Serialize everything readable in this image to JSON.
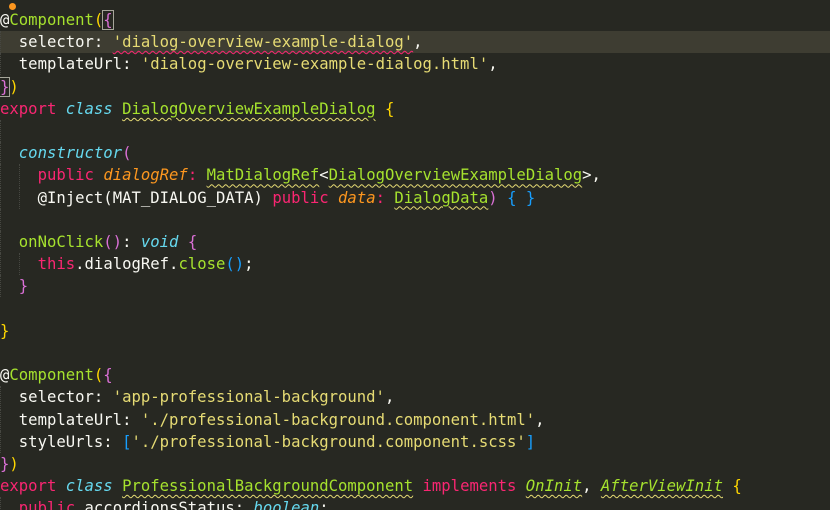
{
  "colors": {
    "background": "#272822",
    "current_line": "#3e3d32",
    "keyword": "#f92672",
    "storage_italic": "#66d9ef",
    "function": "#a6e22e",
    "string": "#e6db74",
    "text": "#f8f8f2",
    "parameter": "#fd971f",
    "bracket_yellow": "#ffd700",
    "bracket_purple": "#da70d6",
    "bracket_blue": "#179fff"
  },
  "lines": [
    [
      {
        "t": "@",
        "c": "#f8f8f2"
      },
      {
        "t": "Component",
        "c": "#a6e22e"
      },
      {
        "t": "(",
        "c": "#ffd700"
      },
      {
        "t": "{",
        "c": "#da70d6",
        "box": true
      }
    ],
    [
      {
        "t": "  selector: ",
        "c": "#f8f8f2"
      },
      {
        "t": "'dialog-overview-example-dialog'",
        "c": "#e6db74",
        "sq": "red"
      },
      {
        "t": ",",
        "c": "#f8f8f2"
      }
    ],
    [
      {
        "t": "  templateUrl: ",
        "c": "#f8f8f2"
      },
      {
        "t": "'dialog-overview-example-dialog.html'",
        "c": "#e6db74"
      },
      {
        "t": ",",
        "c": "#f8f8f2"
      }
    ],
    [
      {
        "t": "}",
        "c": "#da70d6",
        "box": true
      },
      {
        "t": ")",
        "c": "#ffd700"
      }
    ],
    [
      {
        "t": "export",
        "c": "#f92672"
      },
      {
        "t": " ",
        "c": "#f8f8f2"
      },
      {
        "t": "class",
        "c": "#66d9ef",
        "i": true
      },
      {
        "t": " ",
        "c": "#f8f8f2"
      },
      {
        "t": "DialogOverviewExampleDialog",
        "c": "#a6e22e",
        "sq": "yellow"
      },
      {
        "t": " ",
        "c": "#f8f8f2"
      },
      {
        "t": "{",
        "c": "#ffd700"
      }
    ],
    [],
    [
      {
        "t": "  ",
        "c": "#f8f8f2"
      },
      {
        "t": "constructor",
        "c": "#66d9ef",
        "i": true
      },
      {
        "t": "(",
        "c": "#da70d6"
      }
    ],
    [
      {
        "t": "    ",
        "c": "#f8f8f2"
      },
      {
        "t": "public",
        "c": "#f92672"
      },
      {
        "t": " ",
        "c": "#f8f8f2"
      },
      {
        "t": "dialogRef",
        "c": "#fd971f",
        "i": true
      },
      {
        "t": ": ",
        "c": "#f92672"
      },
      {
        "t": "MatDialogRef",
        "c": "#a6e22e",
        "sq": "yellow"
      },
      {
        "t": "<",
        "c": "#f8f8f2"
      },
      {
        "t": "DialogOverviewExampleDialog",
        "c": "#a6e22e",
        "sq": "yellow"
      },
      {
        "t": ">,",
        "c": "#f8f8f2"
      }
    ],
    [
      {
        "t": "    @Inject(MAT_DIALOG_DATA) ",
        "c": "#f8f8f2"
      },
      {
        "t": "public",
        "c": "#f92672"
      },
      {
        "t": " ",
        "c": "#f8f8f2"
      },
      {
        "t": "data",
        "c": "#fd971f",
        "i": true
      },
      {
        "t": ": ",
        "c": "#f92672"
      },
      {
        "t": "DialogData",
        "c": "#a6e22e",
        "sq": "yellow"
      },
      {
        "t": ") ",
        "c": "#da70d6"
      },
      {
        "t": "{ }",
        "c": "#179fff"
      }
    ],
    [],
    [
      {
        "t": "  ",
        "c": "#f8f8f2"
      },
      {
        "t": "onNoClick",
        "c": "#a6e22e"
      },
      {
        "t": "()",
        "c": "#da70d6"
      },
      {
        "t": ": ",
        "c": "#f8f8f2"
      },
      {
        "t": "void",
        "c": "#66d9ef",
        "i": true
      },
      {
        "t": " ",
        "c": "#f8f8f2"
      },
      {
        "t": "{",
        "c": "#da70d6"
      }
    ],
    [
      {
        "t": "    ",
        "c": "#f8f8f2"
      },
      {
        "t": "this",
        "c": "#f92672"
      },
      {
        "t": ".dialogRef.",
        "c": "#f8f8f2"
      },
      {
        "t": "close",
        "c": "#a6e22e"
      },
      {
        "t": "()",
        "c": "#179fff"
      },
      {
        "t": ";",
        "c": "#f8f8f2"
      }
    ],
    [
      {
        "t": "  ",
        "c": "#f8f8f2"
      },
      {
        "t": "}",
        "c": "#da70d6"
      }
    ],
    [],
    [
      {
        "t": "}",
        "c": "#ffd700"
      }
    ],
    [],
    [
      {
        "t": "@",
        "c": "#f8f8f2"
      },
      {
        "t": "Component",
        "c": "#a6e22e"
      },
      {
        "t": "(",
        "c": "#ffd700"
      },
      {
        "t": "{",
        "c": "#da70d6"
      }
    ],
    [
      {
        "t": "  selector: ",
        "c": "#f8f8f2"
      },
      {
        "t": "'app-professional-background'",
        "c": "#e6db74"
      },
      {
        "t": ",",
        "c": "#f8f8f2"
      }
    ],
    [
      {
        "t": "  templateUrl: ",
        "c": "#f8f8f2"
      },
      {
        "t": "'./professional-background.component.html'",
        "c": "#e6db74"
      },
      {
        "t": ",",
        "c": "#f8f8f2"
      }
    ],
    [
      {
        "t": "  styleUrls: ",
        "c": "#f8f8f2"
      },
      {
        "t": "[",
        "c": "#179fff"
      },
      {
        "t": "'./professional-background.component.scss'",
        "c": "#e6db74"
      },
      {
        "t": "]",
        "c": "#179fff"
      }
    ],
    [
      {
        "t": "}",
        "c": "#da70d6"
      },
      {
        "t": ")",
        "c": "#ffd700"
      }
    ],
    [
      {
        "t": "export",
        "c": "#f92672"
      },
      {
        "t": " ",
        "c": "#f8f8f2"
      },
      {
        "t": "class",
        "c": "#66d9ef",
        "i": true
      },
      {
        "t": " ",
        "c": "#f8f8f2"
      },
      {
        "t": "ProfessionalBackgroundComponent",
        "c": "#a6e22e",
        "sq": "yellow"
      },
      {
        "t": " ",
        "c": "#f8f8f2"
      },
      {
        "t": "implements",
        "c": "#f92672"
      },
      {
        "t": " ",
        "c": "#f8f8f2"
      },
      {
        "t": "OnInit",
        "c": "#a6e22e",
        "i": true,
        "sq": "yellow"
      },
      {
        "t": ", ",
        "c": "#f8f8f2"
      },
      {
        "t": "AfterViewInit",
        "c": "#a6e22e",
        "i": true,
        "sq": "yellow"
      },
      {
        "t": " ",
        "c": "#f8f8f2"
      },
      {
        "t": "{",
        "c": "#ffd700"
      }
    ],
    [
      {
        "t": "  ",
        "c": "#f8f8f2"
      },
      {
        "t": "public",
        "c": "#f92672"
      },
      {
        "t": " accordionsStatus: ",
        "c": "#f8f8f2"
      },
      {
        "t": "boolean",
        "c": "#66d9ef",
        "i": true,
        "sq": "yellow"
      },
      {
        "t": ";",
        "c": "#f8f8f2"
      }
    ]
  ],
  "indent_guides": [
    0,
    1,
    1,
    0,
    0,
    1,
    1,
    2,
    2,
    1,
    1,
    2,
    1,
    0,
    0,
    0,
    0,
    1,
    1,
    1,
    0,
    0,
    1
  ],
  "current_line_index": 1
}
